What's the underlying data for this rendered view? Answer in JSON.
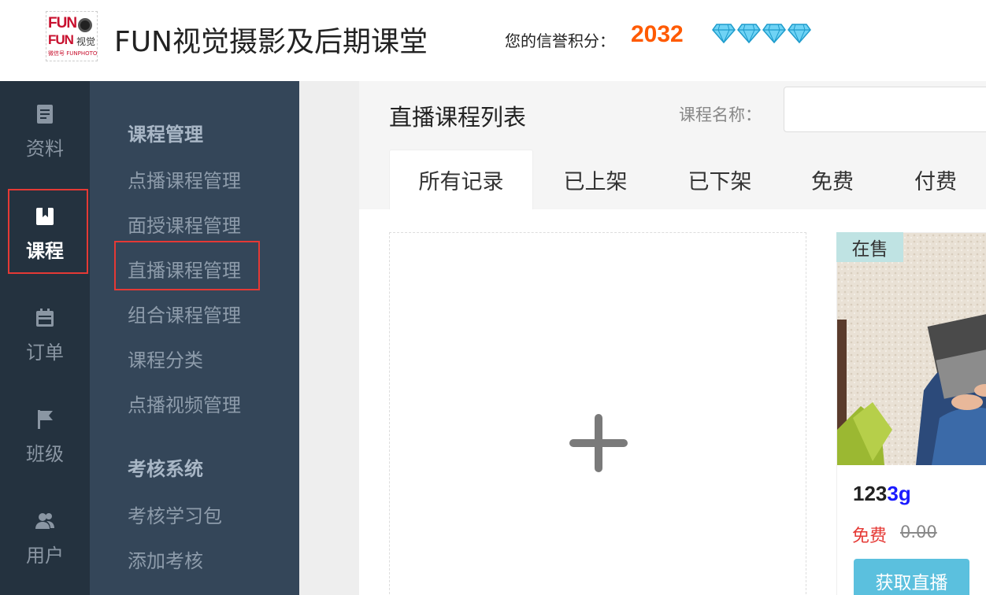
{
  "header": {
    "logo": {
      "line1": "FUN",
      "line2": "FUN",
      "line2_suffix": "视觉",
      "line3": "微信号 FUNPHOTO"
    },
    "site_title": "FUN视觉摄影及后期课堂",
    "credit_label": "您的信誉积分：",
    "credit_value": "2032",
    "diamond_count": 4,
    "credit_color": "#ff5a00"
  },
  "iconbar": {
    "items": [
      {
        "label": "资料",
        "icon": "document-icon"
      },
      {
        "label": "课程",
        "icon": "bookmark-icon",
        "active": true
      },
      {
        "label": "订单",
        "icon": "calendar-icon"
      },
      {
        "label": "班级",
        "icon": "flag-icon"
      },
      {
        "label": "用户",
        "icon": "users-icon"
      }
    ]
  },
  "submenu": {
    "section1": "课程管理",
    "items1": [
      "点播课程管理",
      "面授课程管理",
      "直播课程管理",
      "组合课程管理",
      "课程分类",
      "点播视频管理"
    ],
    "section2": "考核系统",
    "items2": [
      "考核学习包",
      "添加考核"
    ],
    "active_item": "直播课程管理"
  },
  "main": {
    "page_title": "直播课程列表",
    "search_label": "课程名称：",
    "search_value": "",
    "tabs": [
      "所有记录",
      "已上架",
      "已下架",
      "免费",
      "付费"
    ],
    "active_tab": "所有记录"
  },
  "course_card": {
    "status": "在售",
    "name_prefix": "123",
    "name_highlight": "3g",
    "price_label": "免费",
    "original_price": "0.00",
    "action_label": "获取直播",
    "button_color": "#5bc0de"
  }
}
